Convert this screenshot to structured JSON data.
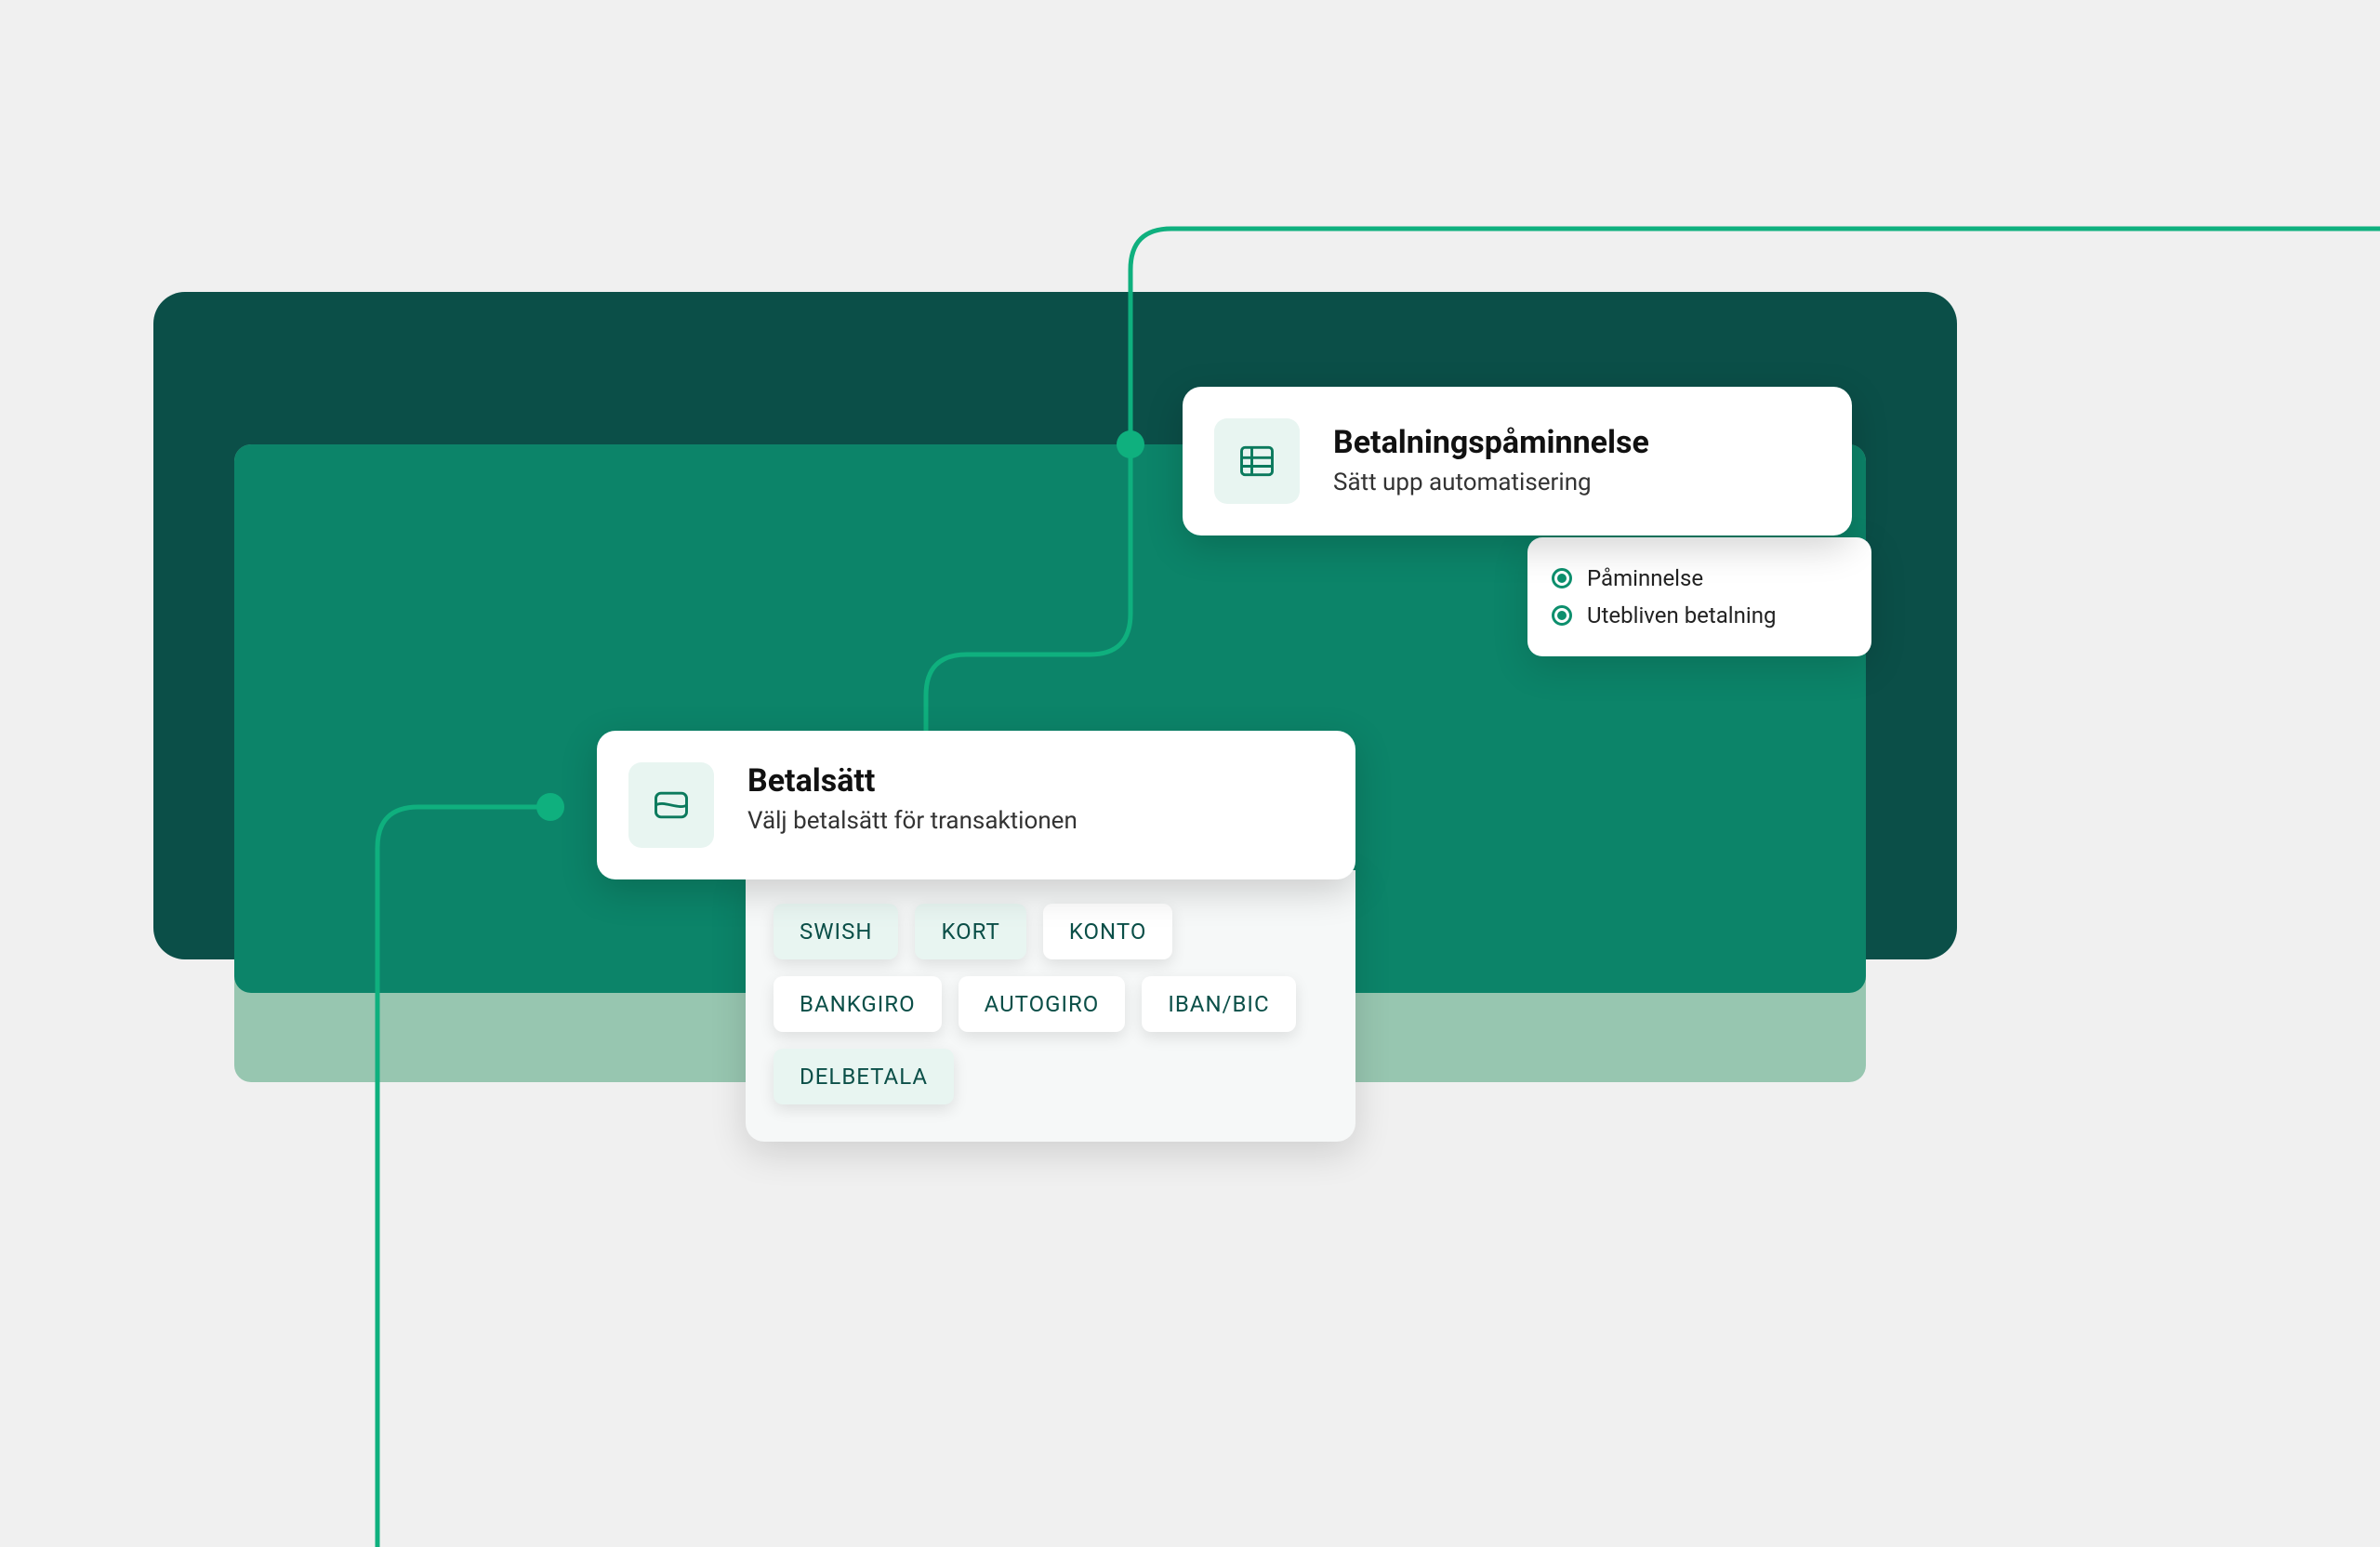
{
  "colors": {
    "bg_dark": "#0b4f48",
    "bg_mid": "#0c8469",
    "bg_light_overlay": "#8abfa6",
    "accent": "#0fb07e",
    "icon_tile_bg": "#e8f5f1",
    "chip_selected_bg": "#e8f5f1",
    "chip_text": "#0b4f48"
  },
  "reminder": {
    "title": "Betalningspåminnelse",
    "subtitle": "Sätt upp automatisering",
    "icon": "table-icon",
    "options": [
      {
        "label": "Påminnelse",
        "checked": true
      },
      {
        "label": "Utebliven betalning",
        "checked": true
      }
    ]
  },
  "method": {
    "title": "Betalsätt",
    "subtitle": "Välj betalsätt för transaktionen",
    "icon": "wallet-icon",
    "chips": [
      {
        "label": "SWISH",
        "selected": true
      },
      {
        "label": "KORT",
        "selected": true
      },
      {
        "label": "KONTO",
        "selected": false
      },
      {
        "label": "BANKGIRO",
        "selected": false
      },
      {
        "label": "AUTOGIRO",
        "selected": false
      },
      {
        "label": "IBAN/BIC",
        "selected": false
      },
      {
        "label": "DELBETALA",
        "selected": true
      }
    ]
  }
}
